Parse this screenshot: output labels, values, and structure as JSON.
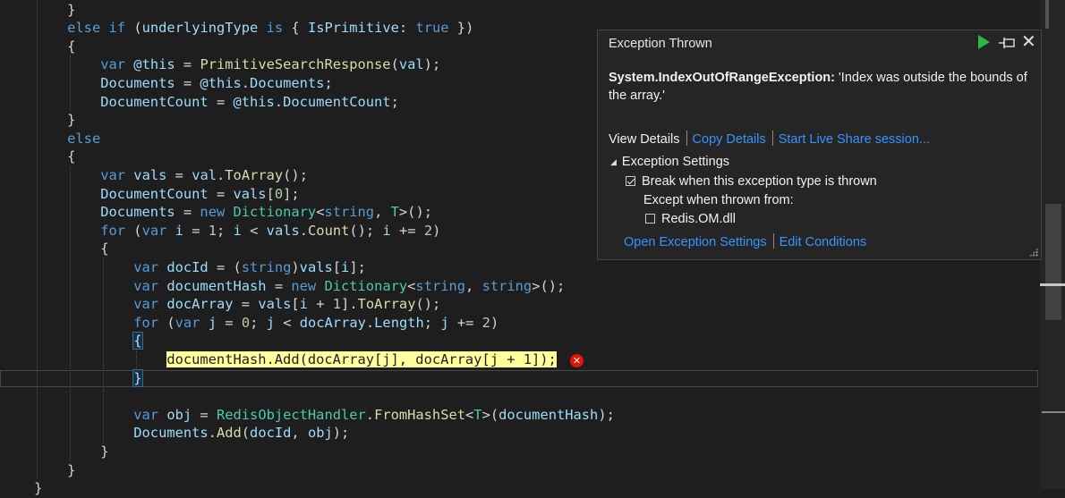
{
  "code_lines": [
    [
      {
        "t": "        ",
        "c": "pl"
      },
      {
        "t": "}",
        "c": "pl"
      }
    ],
    [
      {
        "t": "        ",
        "c": "pl"
      },
      {
        "t": "else",
        "c": "kw"
      },
      {
        "t": " ",
        "c": "pl"
      },
      {
        "t": "if",
        "c": "kw"
      },
      {
        "t": " (",
        "c": "pl"
      },
      {
        "t": "underlyingType",
        "c": "vr"
      },
      {
        "t": " ",
        "c": "pl"
      },
      {
        "t": "is",
        "c": "kw"
      },
      {
        "t": " { ",
        "c": "pl"
      },
      {
        "t": "IsPrimitive",
        "c": "vr"
      },
      {
        "t": ": ",
        "c": "pl"
      },
      {
        "t": "true",
        "c": "kw"
      },
      {
        "t": " })",
        "c": "pl"
      }
    ],
    [
      {
        "t": "        ",
        "c": "pl"
      },
      {
        "t": "{",
        "c": "pl"
      }
    ],
    [
      {
        "t": "            ",
        "c": "pl"
      },
      {
        "t": "var",
        "c": "kw"
      },
      {
        "t": " ",
        "c": "pl"
      },
      {
        "t": "@this",
        "c": "vr"
      },
      {
        "t": " = ",
        "c": "pl"
      },
      {
        "t": "PrimitiveSearchResponse",
        "c": "fn"
      },
      {
        "t": "(",
        "c": "pl"
      },
      {
        "t": "val",
        "c": "vr"
      },
      {
        "t": ");",
        "c": "pl"
      }
    ],
    [
      {
        "t": "            ",
        "c": "pl"
      },
      {
        "t": "Documents",
        "c": "vr"
      },
      {
        "t": " = ",
        "c": "pl"
      },
      {
        "t": "@this",
        "c": "vr"
      },
      {
        "t": ".",
        "c": "pl"
      },
      {
        "t": "Documents",
        "c": "vr"
      },
      {
        "t": ";",
        "c": "pl"
      }
    ],
    [
      {
        "t": "            ",
        "c": "pl"
      },
      {
        "t": "DocumentCount",
        "c": "vr"
      },
      {
        "t": " = ",
        "c": "pl"
      },
      {
        "t": "@this",
        "c": "vr"
      },
      {
        "t": ".",
        "c": "pl"
      },
      {
        "t": "DocumentCount",
        "c": "vr"
      },
      {
        "t": ";",
        "c": "pl"
      }
    ],
    [
      {
        "t": "        ",
        "c": "pl"
      },
      {
        "t": "}",
        "c": "pl"
      }
    ],
    [
      {
        "t": "        ",
        "c": "pl"
      },
      {
        "t": "else",
        "c": "kw"
      }
    ],
    [
      {
        "t": "        ",
        "c": "pl"
      },
      {
        "t": "{",
        "c": "pl"
      }
    ],
    [
      {
        "t": "            ",
        "c": "pl"
      },
      {
        "t": "var",
        "c": "kw"
      },
      {
        "t": " ",
        "c": "pl"
      },
      {
        "t": "vals",
        "c": "vr"
      },
      {
        "t": " = ",
        "c": "pl"
      },
      {
        "t": "val",
        "c": "vr"
      },
      {
        "t": ".",
        "c": "pl"
      },
      {
        "t": "ToArray",
        "c": "fn"
      },
      {
        "t": "();",
        "c": "pl"
      }
    ],
    [
      {
        "t": "            ",
        "c": "pl"
      },
      {
        "t": "DocumentCount",
        "c": "vr"
      },
      {
        "t": " = ",
        "c": "pl"
      },
      {
        "t": "vals",
        "c": "vr"
      },
      {
        "t": "[",
        "c": "pl"
      },
      {
        "t": "0",
        "c": "nu"
      },
      {
        "t": "];",
        "c": "pl"
      }
    ],
    [
      {
        "t": "            ",
        "c": "pl"
      },
      {
        "t": "Documents",
        "c": "vr"
      },
      {
        "t": " = ",
        "c": "pl"
      },
      {
        "t": "new",
        "c": "kw"
      },
      {
        "t": " ",
        "c": "pl"
      },
      {
        "t": "Dictionary",
        "c": "ty"
      },
      {
        "t": "<",
        "c": "pl"
      },
      {
        "t": "string",
        "c": "kw"
      },
      {
        "t": ", ",
        "c": "pl"
      },
      {
        "t": "T",
        "c": "ty"
      },
      {
        "t": ">();",
        "c": "pl"
      }
    ],
    [
      {
        "t": "            ",
        "c": "pl"
      },
      {
        "t": "for",
        "c": "kw"
      },
      {
        "t": " (",
        "c": "pl"
      },
      {
        "t": "var",
        "c": "kw"
      },
      {
        "t": " ",
        "c": "pl"
      },
      {
        "t": "i",
        "c": "vr"
      },
      {
        "t": " = ",
        "c": "pl"
      },
      {
        "t": "1",
        "c": "nu"
      },
      {
        "t": "; ",
        "c": "pl"
      },
      {
        "t": "i",
        "c": "vr"
      },
      {
        "t": " < ",
        "c": "pl"
      },
      {
        "t": "vals",
        "c": "vr"
      },
      {
        "t": ".",
        "c": "pl"
      },
      {
        "t": "Count",
        "c": "fn"
      },
      {
        "t": "(); ",
        "c": "pl"
      },
      {
        "t": "i",
        "c": "vr"
      },
      {
        "t": " += ",
        "c": "pl"
      },
      {
        "t": "2",
        "c": "nu"
      },
      {
        "t": ")",
        "c": "pl"
      }
    ],
    [
      {
        "t": "            ",
        "c": "pl"
      },
      {
        "t": "{",
        "c": "pl"
      }
    ],
    [
      {
        "t": "                ",
        "c": "pl"
      },
      {
        "t": "var",
        "c": "kw"
      },
      {
        "t": " ",
        "c": "pl"
      },
      {
        "t": "docId",
        "c": "vr"
      },
      {
        "t": " = (",
        "c": "pl"
      },
      {
        "t": "string",
        "c": "kw"
      },
      {
        "t": ")",
        "c": "pl"
      },
      {
        "t": "vals",
        "c": "vr"
      },
      {
        "t": "[",
        "c": "pl"
      },
      {
        "t": "i",
        "c": "vr"
      },
      {
        "t": "];",
        "c": "pl"
      }
    ],
    [
      {
        "t": "                ",
        "c": "pl"
      },
      {
        "t": "var",
        "c": "kw"
      },
      {
        "t": " ",
        "c": "pl"
      },
      {
        "t": "documentHash",
        "c": "vr"
      },
      {
        "t": " = ",
        "c": "pl"
      },
      {
        "t": "new",
        "c": "kw"
      },
      {
        "t": " ",
        "c": "pl"
      },
      {
        "t": "Dictionary",
        "c": "ty"
      },
      {
        "t": "<",
        "c": "pl"
      },
      {
        "t": "string",
        "c": "kw"
      },
      {
        "t": ", ",
        "c": "pl"
      },
      {
        "t": "string",
        "c": "kw"
      },
      {
        "t": ">();",
        "c": "pl"
      }
    ],
    [
      {
        "t": "                ",
        "c": "pl"
      },
      {
        "t": "var",
        "c": "kw"
      },
      {
        "t": " ",
        "c": "pl"
      },
      {
        "t": "docArray",
        "c": "vr"
      },
      {
        "t": " = ",
        "c": "pl"
      },
      {
        "t": "vals",
        "c": "vr"
      },
      {
        "t": "[",
        "c": "pl"
      },
      {
        "t": "i",
        "c": "vr"
      },
      {
        "t": " + ",
        "c": "pl"
      },
      {
        "t": "1",
        "c": "nu"
      },
      {
        "t": "].",
        "c": "pl"
      },
      {
        "t": "ToArray",
        "c": "fn"
      },
      {
        "t": "();",
        "c": "pl"
      }
    ],
    [
      {
        "t": "                ",
        "c": "pl"
      },
      {
        "t": "for",
        "c": "kw"
      },
      {
        "t": " (",
        "c": "pl"
      },
      {
        "t": "var",
        "c": "kw"
      },
      {
        "t": " ",
        "c": "pl"
      },
      {
        "t": "j",
        "c": "vr"
      },
      {
        "t": " = ",
        "c": "pl"
      },
      {
        "t": "0",
        "c": "nu"
      },
      {
        "t": "; ",
        "c": "pl"
      },
      {
        "t": "j",
        "c": "vr"
      },
      {
        "t": " < ",
        "c": "pl"
      },
      {
        "t": "docArray",
        "c": "vr"
      },
      {
        "t": ".",
        "c": "pl"
      },
      {
        "t": "Length",
        "c": "vr"
      },
      {
        "t": "; ",
        "c": "pl"
      },
      {
        "t": "j",
        "c": "vr"
      },
      {
        "t": " += ",
        "c": "pl"
      },
      {
        "t": "2",
        "c": "nu"
      },
      {
        "t": ")",
        "c": "pl"
      }
    ],
    [
      {
        "t": "                ",
        "c": "pl"
      },
      {
        "t": "{",
        "c": "bm"
      }
    ],
    [
      {
        "t": "                    ",
        "c": "pl"
      },
      {
        "t": "documentHash.Add(docArray[j], docArray[j + 1]);",
        "c": "hl"
      }
    ],
    [
      {
        "t": "                ",
        "c": "pl"
      },
      {
        "t": "}",
        "c": "bm"
      }
    ],
    [],
    [
      {
        "t": "                ",
        "c": "pl"
      },
      {
        "t": "var",
        "c": "kw"
      },
      {
        "t": " ",
        "c": "pl"
      },
      {
        "t": "obj",
        "c": "vr"
      },
      {
        "t": " = ",
        "c": "pl"
      },
      {
        "t": "RedisObjectHandler",
        "c": "ty"
      },
      {
        "t": ".",
        "c": "pl"
      },
      {
        "t": "FromHashSet",
        "c": "fn"
      },
      {
        "t": "<",
        "c": "pl"
      },
      {
        "t": "T",
        "c": "ty"
      },
      {
        "t": ">(",
        "c": "pl"
      },
      {
        "t": "documentHash",
        "c": "vr"
      },
      {
        "t": ");",
        "c": "pl"
      }
    ],
    [
      {
        "t": "                ",
        "c": "pl"
      },
      {
        "t": "Documents",
        "c": "vr"
      },
      {
        "t": ".",
        "c": "pl"
      },
      {
        "t": "Add",
        "c": "fn"
      },
      {
        "t": "(",
        "c": "pl"
      },
      {
        "t": "docId",
        "c": "vr"
      },
      {
        "t": ", ",
        "c": "pl"
      },
      {
        "t": "obj",
        "c": "vr"
      },
      {
        "t": ");",
        "c": "pl"
      }
    ],
    [
      {
        "t": "            ",
        "c": "pl"
      },
      {
        "t": "}",
        "c": "pl"
      }
    ],
    [
      {
        "t": "        ",
        "c": "pl"
      },
      {
        "t": "}",
        "c": "pl"
      }
    ],
    [
      {
        "t": "    ",
        "c": "pl"
      },
      {
        "t": "}",
        "c": "pl"
      }
    ]
  ],
  "exception": {
    "title": "Exception Thrown",
    "type": "System.IndexOutOfRangeException:",
    "message": " 'Index was outside the bounds of the array.'",
    "view_details": "View Details",
    "copy_details": "Copy Details",
    "live_share": "Start Live Share session...",
    "settings_header": "Exception Settings",
    "break_label": "Break when this exception type is thrown",
    "break_checked": true,
    "except_label": "Except when thrown from:",
    "module_label": "Redis.OM.dll",
    "module_checked": false,
    "open_settings": "Open Exception Settings",
    "edit_conditions": "Edit Conditions",
    "icons": [
      "continue-play-icon",
      "pin-icon",
      "close-icon"
    ]
  },
  "error_glyph": "✕",
  "colors": {
    "keyword": "#569cd6",
    "type": "#4ec9b0",
    "function": "#dcdcaa",
    "variable": "#9cdcfe",
    "number": "#b5cea8",
    "statement_highlight": "#ffff9c",
    "error": "#e51400",
    "link": "#3794ff"
  }
}
